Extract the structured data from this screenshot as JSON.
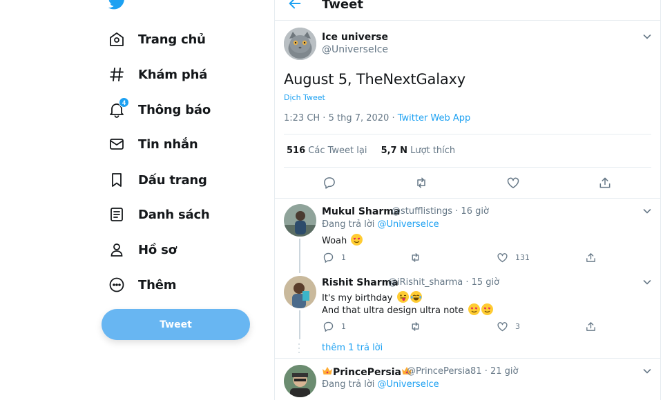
{
  "sidebar": {
    "logo": "twitter-bird-icon",
    "items": [
      {
        "label": "Trang chủ",
        "icon": "home-icon"
      },
      {
        "label": "Khám phá",
        "icon": "hashtag-icon"
      },
      {
        "label": "Thông báo",
        "icon": "bell-icon",
        "badge": "4"
      },
      {
        "label": "Tin nhắn",
        "icon": "mail-icon"
      },
      {
        "label": "Dấu trang",
        "icon": "bookmark-icon"
      },
      {
        "label": "Danh sách",
        "icon": "list-icon"
      },
      {
        "label": "Hồ sơ",
        "icon": "person-icon"
      },
      {
        "label": "Thêm",
        "icon": "more-circle-icon"
      }
    ],
    "tweet_button": "Tweet"
  },
  "header": {
    "title": "Tweet"
  },
  "tweet": {
    "author": "Ice universe",
    "handle": "@UniverseIce",
    "text": "August 5, TheNextGalaxy",
    "translate": "Dịch Tweet",
    "time": "1:23 CH · 5 thg 7, 2020 · ",
    "source": "Twitter Web App",
    "retweets_count": "516",
    "retweets_label": " Các Tweet lại",
    "likes_count": "5,7 N",
    "likes_label": " Lượt thích"
  },
  "replies": [
    {
      "name": "Mukul Sharma",
      "meta": "@stufflistings · 16 giờ",
      "replying_prefix": "Đang trả lời ",
      "replying_to": "@UniverseIce",
      "lines": [
        "Woah"
      ],
      "reply_count": "1",
      "like_count": "131"
    },
    {
      "name": "Rishit Sharma",
      "meta": "@iRishit_sharma · 15 giờ",
      "lines": [
        "It's my birthday",
        "And that ultra design ultra note"
      ],
      "reply_count": "1",
      "like_count": "3"
    },
    {
      "name": "PrincePersia",
      "meta": "@PrincePersia81 · 21 giờ",
      "replying_prefix": "Đang trả lời ",
      "replying_to": "@UniverseIce"
    }
  ],
  "more_replies": "thêm 1 trả lời",
  "colors": {
    "accent": "#1da1f2",
    "tweet_button": "#68b6f2",
    "muted": "#657786",
    "border": "#e6ecf0"
  }
}
